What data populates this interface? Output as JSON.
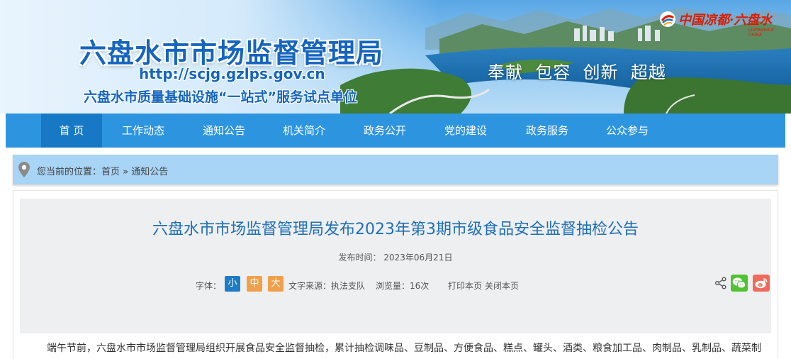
{
  "banner": {
    "title": "六盘水市市场监督管理局",
    "url": "http://scjg.gzlps.gov.cn",
    "subtitle": "六盘水市质量基础设施“一站式”服务试点单位",
    "slogan": "奉献  包容  创新  超越",
    "brand": "中国凉都·六盘水",
    "brand_small": "LIUPANSHUI CHINA"
  },
  "nav": {
    "items": [
      {
        "label": "首 页",
        "active": true
      },
      {
        "label": "工作动态"
      },
      {
        "label": "通知公告"
      },
      {
        "label": "机关简介"
      },
      {
        "label": "政务公开"
      },
      {
        "label": "党的建设"
      },
      {
        "label": "政务服务"
      },
      {
        "label": "公众参与"
      }
    ]
  },
  "breadcrumb": {
    "prefix": "您当前的位置：",
    "home": "首页",
    "sep": "»",
    "current": "通知公告"
  },
  "article": {
    "title": "六盘水市市场监督管理局发布2023年第3期市级食品安全监督抽检公告",
    "pub_time": "发布时间： 2023年06月21日",
    "font_label": "字体：",
    "font_small": "小",
    "font_medium": "中",
    "font_large": "大",
    "source": "文字来源：执法支队",
    "views": "浏览量：16次",
    "print": "打印本页",
    "close": "关闭本页",
    "body": "端午节前，六盘水市市场监督管理局组织开展食品安全监督抽检，累计抽检调味品、豆制品、方便食品、糕点、罐头、酒类、粮食加工品、肉制品、乳制品、蔬菜制"
  },
  "colors": {
    "nav_bg": "#2d95e0",
    "nav_active": "#1778c5",
    "title_blue": "#1f6fb5",
    "font_small_btn": "#1e7bc6",
    "font_mid_btn": "#f0a04b",
    "font_large_btn": "#f0a04b",
    "wechat": "#51c332",
    "weibo": "#f06a5b"
  },
  "icons": {
    "location": "map-pin-icon",
    "share": "share-icon",
    "wechat": "wechat-icon",
    "weibo": "weibo-icon"
  }
}
